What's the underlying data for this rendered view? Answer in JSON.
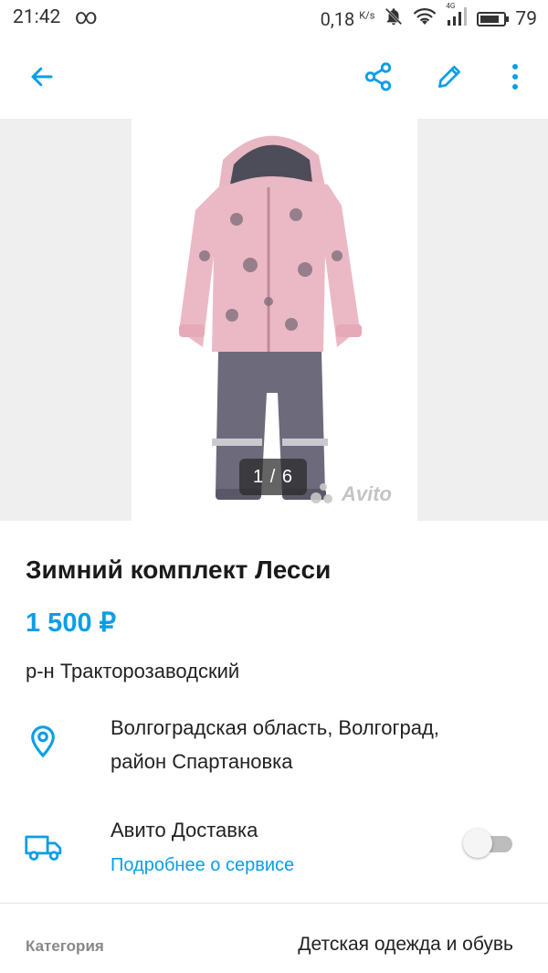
{
  "status_bar": {
    "time": "21:42",
    "infinity": "∞",
    "speed": "0,18",
    "speed_unit": "K/s",
    "network": "4G",
    "battery": "79"
  },
  "toolbar": {
    "back_icon": "arrow-left-icon",
    "share_icon": "share-icon",
    "edit_icon": "pencil-icon",
    "more_icon": "more-vertical-icon",
    "accent": "#0a9ee6"
  },
  "gallery": {
    "counter": "1 / 6",
    "watermark": "Avito"
  },
  "listing": {
    "title": "Зимний комплект Лесси",
    "price": "1 500 ₽",
    "district": "р-н Тракторозаводский",
    "address_line1": "Волгоградская область, Волгоград,",
    "address_line2": "район Спартановка",
    "delivery_title": "Авито Доставка",
    "delivery_link": "Подробнее о сервисе",
    "delivery_enabled": false,
    "category_label": "Категория",
    "category_value": "Детская одежда и обувь"
  }
}
